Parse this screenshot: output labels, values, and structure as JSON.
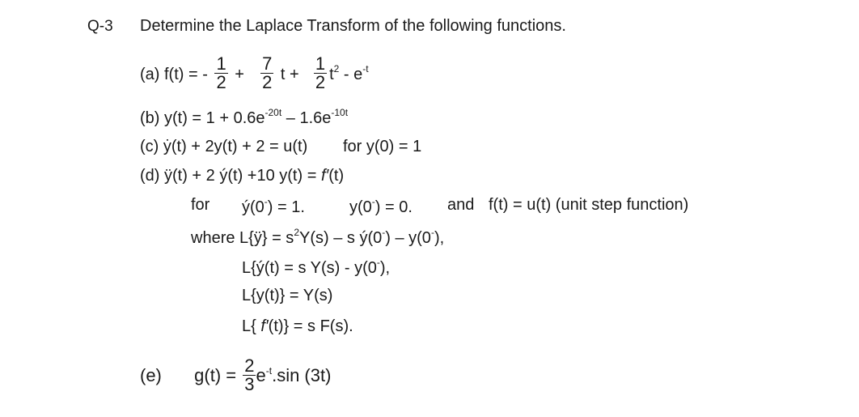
{
  "question": {
    "number": "Q-3",
    "prompt": "Determine the Laplace Transform of the following functions."
  },
  "parts": {
    "a": {
      "label": "(a) f(t) = -",
      "frac1": {
        "num": "1",
        "den": "2"
      },
      "op1": "+",
      "frac2": {
        "num": "7",
        "den": "2"
      },
      "term2": "t +",
      "frac3": {
        "num": "1",
        "den": "2"
      },
      "term3": "t",
      "term3_exp": "2",
      "term4": "- e",
      "term4_exp": "-t"
    },
    "b": {
      "prefix": "(b) y(t) = 1 + 0.6e",
      "exp1": "-20t",
      "mid": " – 1.6e",
      "exp2": "-10t"
    },
    "c": {
      "equation": "(c) ẏ(t) + 2y(t) + 2 = u(t)",
      "condition": "for y(0) = 1"
    },
    "d": {
      "equation_prefix": "(d) ÿ(t) + 2 ý(t) +10 y(t) = ",
      "equation_f": "f′",
      "equation_suffix": "(t)",
      "for_label": "for",
      "ic1_a": "ý(0",
      "ic1_sup": "-",
      "ic1_b": ") = 1.",
      "ic2_a": "y(0",
      "ic2_sup": "-",
      "ic2_b": ") = 0.",
      "and_label": "and",
      "forcing": "f(t) = u(t) (unit step function)",
      "where_a": "where L{ÿ} = s",
      "where_sup": "2",
      "where_b": "Y(s) – s ý(0",
      "where_sup2": "-",
      "where_c": ") – y(0",
      "where_sup3": "-",
      "where_d": "),",
      "l1_a": "L{ý(t) = s Y(s) - y(0",
      "l1_sup": "-",
      "l1_b": "),",
      "l2": "L{y(t)} = Y(s)",
      "l3_a": "L{ ",
      "l3_f": "f′",
      "l3_b": "(t)} = s F(s)."
    },
    "e": {
      "label": "(e)",
      "lhs": "g(t) =",
      "frac": {
        "num": "2",
        "den": "3"
      },
      "rhs_a": "e",
      "rhs_exp": "-t",
      "rhs_b": ".sin (3t)"
    }
  }
}
